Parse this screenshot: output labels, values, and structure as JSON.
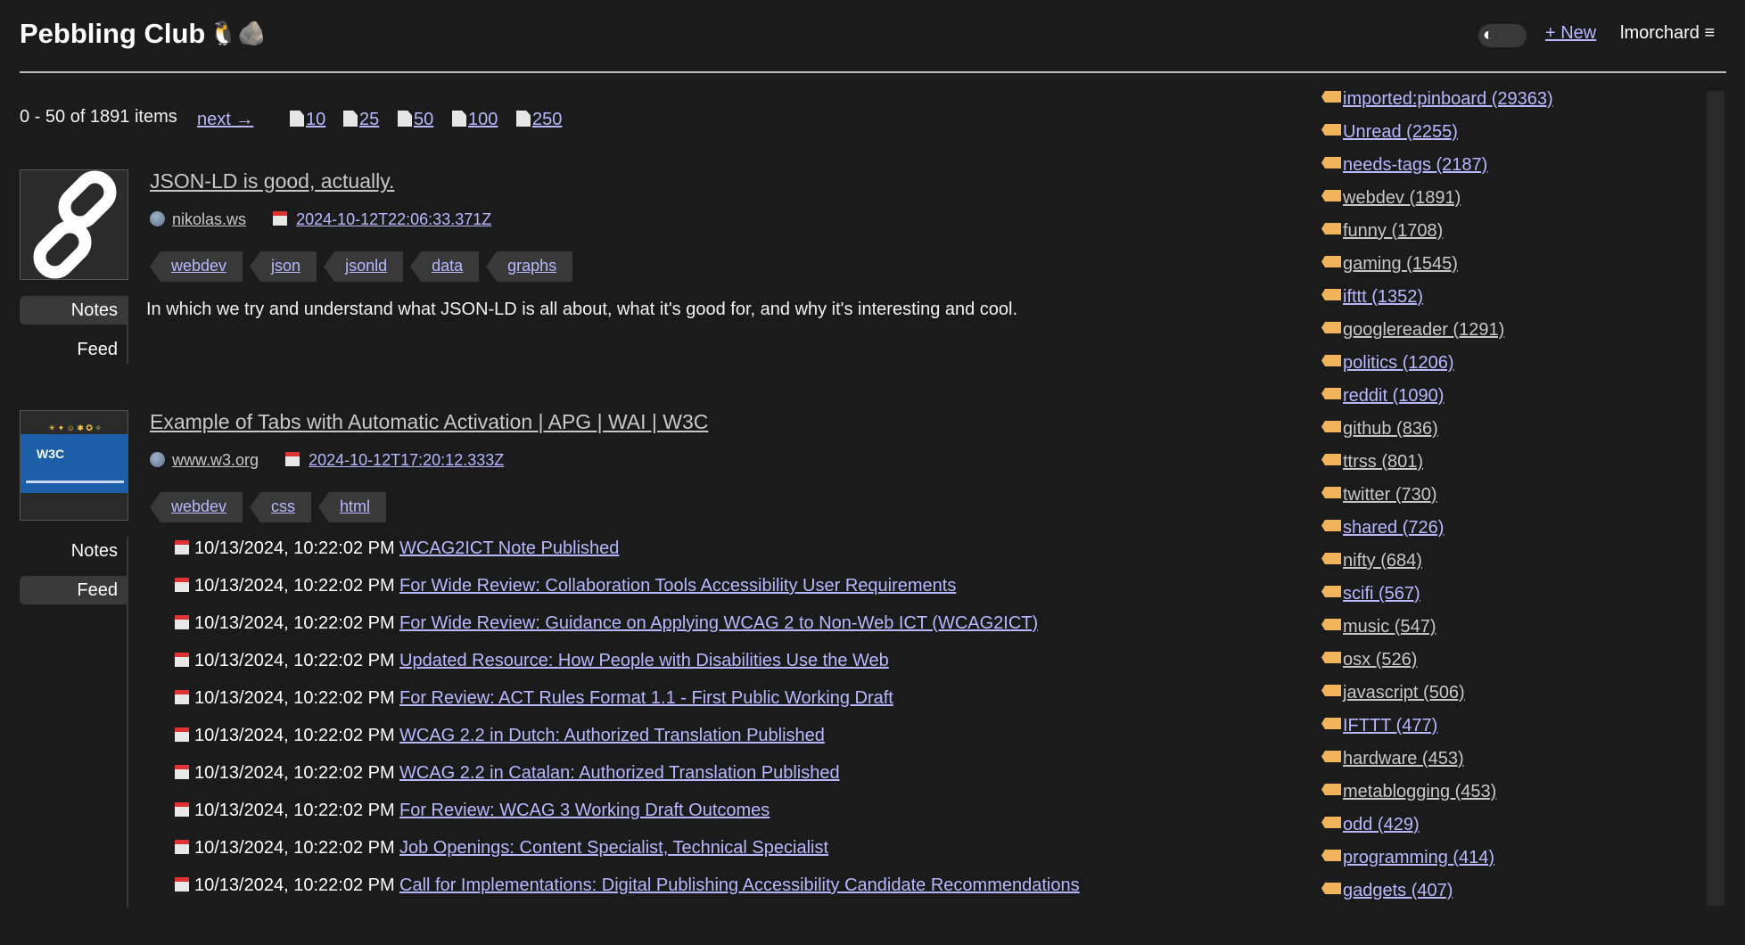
{
  "header": {
    "site_title": "Pebbling Club",
    "site_emoji": "🐧🪨",
    "theme_toggle_glyph": "◐",
    "new_label": "+ New",
    "username": "lmorchard",
    "menu_glyph": "≡"
  },
  "pager": {
    "count_text": "0 - 50 of 1891 items",
    "next_label": "next →",
    "limits": [
      "10",
      "25",
      "50",
      "100",
      "250"
    ]
  },
  "items": [
    {
      "title": "JSON-LD is good, actually.",
      "site": "nikolas.ws",
      "date": "2024-10-12T22:06:33.371Z",
      "tags": [
        "webdev",
        "json",
        "jsonld",
        "data",
        "graphs"
      ],
      "tabs": [
        "Notes",
        "Feed"
      ],
      "active_tab": "Notes",
      "description": "In which we try and understand what JSON-LD is all about, what it's good for, and why it's interesting and cool."
    },
    {
      "title": "Example of Tabs with Automatic Activation | APG | WAI | W3C",
      "site": "www.w3.org",
      "date": "2024-10-12T17:20:12.333Z",
      "tags": [
        "webdev",
        "css",
        "html"
      ],
      "tabs": [
        "Notes",
        "Feed"
      ],
      "active_tab": "Feed",
      "thumb_text": "W3C",
      "feed": [
        {
          "date": "10/13/2024, 10:22:02 PM",
          "title": "WCAG2ICT Note Published"
        },
        {
          "date": "10/13/2024, 10:22:02 PM",
          "title": "For Wide Review: Collaboration Tools Accessibility User Requirements"
        },
        {
          "date": "10/13/2024, 10:22:02 PM",
          "title": "For Wide Review: Guidance on Applying WCAG 2 to Non-Web ICT (WCAG2ICT)"
        },
        {
          "date": "10/13/2024, 10:22:02 PM",
          "title": "Updated Resource: How People with Disabilities Use the Web"
        },
        {
          "date": "10/13/2024, 10:22:02 PM",
          "title": "For Review: ACT Rules Format 1.1 - First Public Working Draft"
        },
        {
          "date": "10/13/2024, 10:22:02 PM",
          "title": "WCAG 2.2 in Dutch: Authorized Translation Published"
        },
        {
          "date": "10/13/2024, 10:22:02 PM",
          "title": "WCAG 2.2 in Catalan: Authorized Translation Published"
        },
        {
          "date": "10/13/2024, 10:22:02 PM",
          "title": "For Review: WCAG 3 Working Draft Outcomes"
        },
        {
          "date": "10/13/2024, 10:22:02 PM",
          "title": "Job Openings: Content Specialist, Technical Specialist"
        },
        {
          "date": "10/13/2024, 10:22:02 PM",
          "title": "Call for Implementations: Digital Publishing Accessibility Candidate Recommendations"
        }
      ]
    }
  ],
  "sidebar_tags": [
    {
      "label": "imported:pinboard (29363)",
      "highlight": true
    },
    {
      "label": "Unread (2255)",
      "highlight": true
    },
    {
      "label": "needs-tags (2187)",
      "highlight": true
    },
    {
      "label": "webdev (1891)",
      "highlight": false
    },
    {
      "label": "funny (1708)",
      "highlight": false
    },
    {
      "label": "gaming (1545)",
      "highlight": false
    },
    {
      "label": "ifttt (1352)",
      "highlight": true
    },
    {
      "label": "googlereader (1291)",
      "highlight": false
    },
    {
      "label": "politics (1206)",
      "highlight": true
    },
    {
      "label": "reddit (1090)",
      "highlight": true
    },
    {
      "label": "github (836)",
      "highlight": false
    },
    {
      "label": "ttrss (801)",
      "highlight": false
    },
    {
      "label": "twitter (730)",
      "highlight": false
    },
    {
      "label": "shared (726)",
      "highlight": true
    },
    {
      "label": "nifty (684)",
      "highlight": false
    },
    {
      "label": "scifi (567)",
      "highlight": true
    },
    {
      "label": "music (547)",
      "highlight": false
    },
    {
      "label": "osx (526)",
      "highlight": false
    },
    {
      "label": "javascript (506)",
      "highlight": false
    },
    {
      "label": "IFTTT (477)",
      "highlight": true
    },
    {
      "label": "hardware (453)",
      "highlight": false
    },
    {
      "label": "metablogging (453)",
      "highlight": false
    },
    {
      "label": "odd (429)",
      "highlight": true
    },
    {
      "label": "programming (414)",
      "highlight": true
    },
    {
      "label": "gadgets (407)",
      "highlight": true
    }
  ],
  "colors": {
    "background": "#1c1b1c",
    "link": "#b8b8ff",
    "tag_bg": "#3a393a",
    "label_icon": "#f2b45a"
  }
}
